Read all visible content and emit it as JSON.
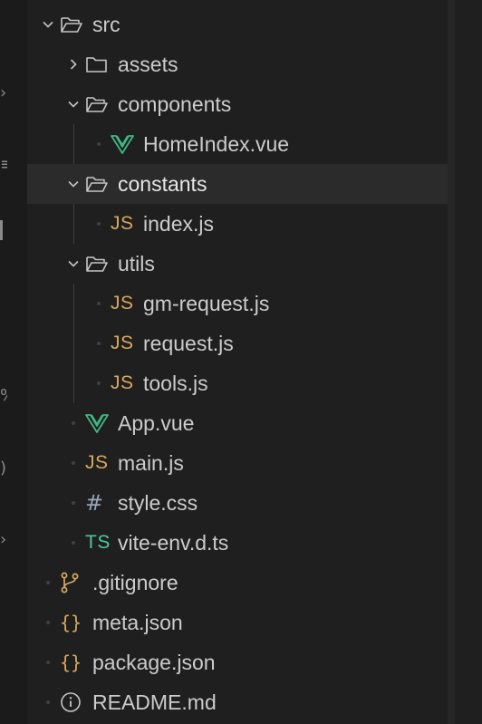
{
  "explorer": {
    "items": [
      {
        "label": "src",
        "kind": "folder-open",
        "icon": "folder-open-icon",
        "depth": 0,
        "chevron": "down"
      },
      {
        "label": "assets",
        "kind": "folder",
        "icon": "folder-icon",
        "depth": 1,
        "chevron": "right"
      },
      {
        "label": "components",
        "kind": "folder-open",
        "icon": "folder-open-icon",
        "depth": 1,
        "chevron": "down"
      },
      {
        "label": "HomeIndex.vue",
        "kind": "vue",
        "icon": "vue-icon",
        "depth": 2
      },
      {
        "label": "constants",
        "kind": "folder-open",
        "icon": "folder-open-icon",
        "depth": 1,
        "chevron": "down",
        "selected": true
      },
      {
        "label": "index.js",
        "kind": "js",
        "icon": "js-icon",
        "depth": 2
      },
      {
        "label": "utils",
        "kind": "folder-open",
        "icon": "folder-open-icon",
        "depth": 1,
        "chevron": "down"
      },
      {
        "label": "gm-request.js",
        "kind": "js",
        "icon": "js-icon",
        "depth": 2
      },
      {
        "label": "request.js",
        "kind": "js",
        "icon": "js-icon",
        "depth": 2
      },
      {
        "label": "tools.js",
        "kind": "js",
        "icon": "js-icon",
        "depth": 2
      },
      {
        "label": "App.vue",
        "kind": "vue",
        "icon": "vue-icon",
        "depth": 1
      },
      {
        "label": "main.js",
        "kind": "js",
        "icon": "js-icon",
        "depth": 1
      },
      {
        "label": "style.css",
        "kind": "css",
        "icon": "css-hash-icon",
        "depth": 1
      },
      {
        "label": "vite-env.d.ts",
        "kind": "ts",
        "icon": "ts-icon",
        "depth": 1
      },
      {
        "label": ".gitignore",
        "kind": "git",
        "icon": "git-branch-icon",
        "depth": 0
      },
      {
        "label": "meta.json",
        "kind": "json",
        "icon": "json-braces-icon",
        "depth": 0
      },
      {
        "label": "package.json",
        "kind": "json",
        "icon": "json-braces-icon",
        "depth": 0
      },
      {
        "label": "README.md",
        "kind": "info",
        "icon": "info-icon",
        "depth": 0
      }
    ],
    "icon_text": {
      "js": "JS",
      "ts": "TS",
      "css": "#",
      "json": "{}"
    }
  },
  "colors": {
    "background": "#1f1f1f",
    "selected_row": "#2b2b2b",
    "text": "#cccccc",
    "js": "#d7a85f",
    "ts": "#4ec99b",
    "vue_green": "#41b883",
    "vue_dark": "#35495e",
    "folder_stroke": "#c5c5c5"
  }
}
